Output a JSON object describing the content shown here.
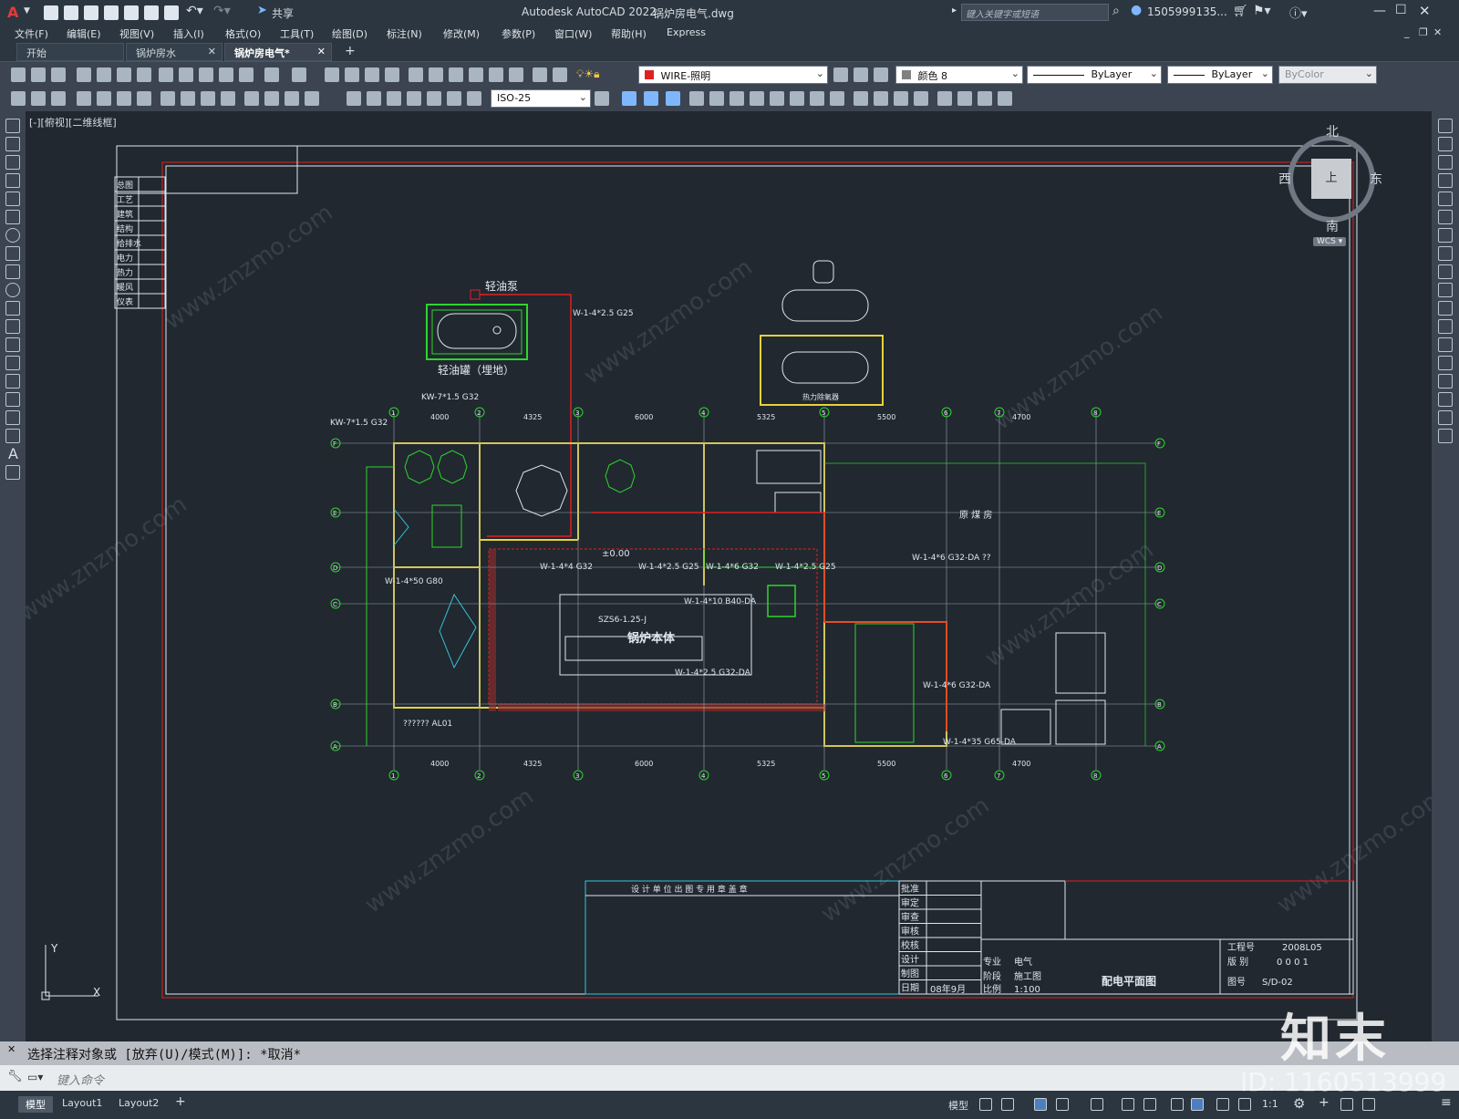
{
  "titlebar": {
    "app_title": "Autodesk AutoCAD 2022",
    "file_name": "锅炉房电气.dwg",
    "share_label": "共享",
    "search_placeholder": "键入关键字或短语",
    "user_name": "1505999135..."
  },
  "menu": [
    "文件(F)",
    "编辑(E)",
    "视图(V)",
    "插入(I)",
    "格式(O)",
    "工具(T)",
    "绘图(D)",
    "标注(N)",
    "修改(M)",
    "参数(P)",
    "窗口(W)",
    "帮助(H)",
    "Express"
  ],
  "tabs": [
    {
      "label": "开始",
      "active": false
    },
    {
      "label": "锅炉房水",
      "active": false
    },
    {
      "label": "锅炉房电气*",
      "active": true
    }
  ],
  "toolbar": {
    "layer_value": "WIRE-照明",
    "color_value": "颜色 8",
    "linetype_value": "ByLayer",
    "lineweight_value": "ByLayer",
    "plotstyle_value": "ByColor",
    "dimstyle_value": "ISO-25"
  },
  "viewport": {
    "label": "[-][俯视][二维线框]"
  },
  "viewcube": {
    "north": "北",
    "south": "南",
    "east": "东",
    "west": "西",
    "top": "上",
    "wcs": "WCS"
  },
  "ucs": {
    "x": "X",
    "y": "Y"
  },
  "drawing": {
    "side_table": [
      "总图",
      "工艺",
      "建筑",
      "结构",
      "给排水",
      "电力",
      "热力",
      "暖风",
      "仪表"
    ],
    "labels": {
      "light_oil_pump": "轻油泵",
      "light_oil_tank": "轻油罐（埋地）",
      "boiler_body": "锅炉本体",
      "boiler_model": "SZS6-1.25-J",
      "raw_water_room": "原 煤 房",
      "deaerator": "热力除氧器",
      "elevation": "±0.00",
      "kw_1": "KW-7*1.5 G32",
      "kw_2": "KW-7*1.5 G32",
      "w_1": "W-1-4*2.5 G25",
      "w_2": "W-1-4*50 G80",
      "w_3": "W-1-4*4 G32",
      "w_4": "W-1-4*2.5 G25",
      "w_5": "W-1-4*6 G32",
      "w_6": "W-1-4*2.5 G25",
      "w_7": "W-1-4*10 B40-DA",
      "w_8": "W-1-4*2.5 G32-DA",
      "w_9": "W-1-4*6 G32-DA ??",
      "w_10": "W-1-4*6 G32-DA",
      "w_11": "W-1-4*35 G65-DA",
      "al01": "?????? AL01",
      "dim_4000": "4000",
      "dim_4325": "4325",
      "dim_6000": "6000",
      "dim_5325": "5325",
      "dim_5500": "5500",
      "dim_4700": "4700",
      "axes_x": [
        "1",
        "2",
        "3",
        "4",
        "5",
        "6",
        "7",
        "8"
      ],
      "axes_y": [
        "A",
        "B",
        "C",
        "D",
        "E",
        "F"
      ]
    },
    "title_block": {
      "stamp_header": "设 计 单 位 出 图 专 用 章 盖 章",
      "rows": [
        "批准",
        "审定",
        "审查",
        "审核",
        "校核",
        "设计",
        "制图",
        "日期"
      ],
      "project_no_label": "工程号",
      "project_no": "2008L05",
      "version_label": "版 别",
      "version": "0 0 0 1",
      "specialty_label": "专业",
      "specialty": "电气",
      "stage_label": "阶段",
      "stage": "施工图",
      "scale_label": "比例",
      "scale": "1:100",
      "date": "08年9月",
      "drawing_title": "配电平面图",
      "drawing_no_label": "图号",
      "drawing_no": "S/D-02"
    }
  },
  "watermark": {
    "brand": "知末",
    "site": "www.znzmo.com",
    "cn_site": "知末网",
    "id": "ID: 1160513999"
  },
  "command": {
    "history": "选择注释对象或 [放弃(U)/模式(M)]: *取消*",
    "placeholder": "键入命令"
  },
  "status": {
    "layout_tabs": [
      "模型",
      "Layout1",
      "Layout2"
    ],
    "model_label": "模型",
    "scale": "1:1"
  },
  "colors": {
    "background": "#212830",
    "wall_green": "#2dd62d",
    "wire_red": "#e02020",
    "yellow": "#e6d23a",
    "cyan": "#33c6d6",
    "white_line": "#dfe6ee"
  }
}
